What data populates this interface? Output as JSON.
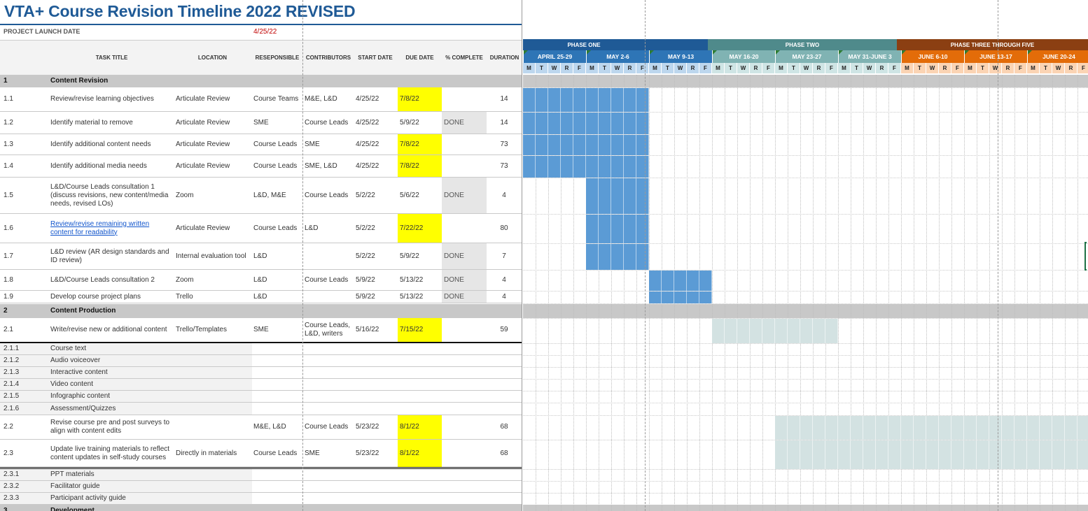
{
  "sheet": {
    "title": "VTA+ Course Revision Timeline 2022 REVISED",
    "launch_label": "PROJECT LAUNCH DATE",
    "launch_date": "4/25/22"
  },
  "columns": {
    "task": "TASK TITLE",
    "location": "LOCATION",
    "responsible": "RESEPONSIBLE",
    "contributors": "CONTRIBUTORS",
    "start": "START DATE",
    "due": "DUE DATE",
    "pct": "% COMPLETE",
    "duration": "DURATION"
  },
  "rows": [
    {
      "num": "1",
      "task": "Content Revision",
      "type": "section"
    },
    {
      "num": "1.1",
      "task": "Review/revise learning objectives",
      "loc": "Articulate Review",
      "resp": "Course Teams",
      "con": "M&E, L&D",
      "start": "4/25/22",
      "due": "7/8/22",
      "due_hl": true,
      "pct": "",
      "dur": "14"
    },
    {
      "num": "1.2",
      "task": "Identify material to remove",
      "loc": "Articulate Review",
      "resp": "SME",
      "con": "Course Leads",
      "start": "4/25/22",
      "due": "5/9/22",
      "pct": "DONE",
      "dur": "14"
    },
    {
      "num": "1.3",
      "task": "Identify additional content needs",
      "loc": "Articulate Review",
      "resp": "Course Leads",
      "con": "SME",
      "start": "4/25/22",
      "due": "7/8/22",
      "due_hl": true,
      "pct": "",
      "dur": "73"
    },
    {
      "num": "1.4",
      "task": "Identify additional media needs",
      "loc": "Articulate Review",
      "resp": "Course Leads",
      "con": "SME, L&D",
      "start": "4/25/22",
      "due": "7/8/22",
      "due_hl": true,
      "pct": "",
      "dur": "73"
    },
    {
      "num": "1.5",
      "task": "L&D/Course Leads consultation 1 (discuss revisions, new content/media needs, revised LOs)",
      "loc": "Zoom",
      "resp": "L&D, M&E",
      "con": "Course Leads",
      "start": "5/2/22",
      "due": "5/6/22",
      "pct": "DONE",
      "dur": "4"
    },
    {
      "num": "1.6",
      "task": "Review/revise remaining written content for readability",
      "link": true,
      "loc": "Articulate Review",
      "resp": "Course Leads",
      "con": "L&D",
      "start": "5/2/22",
      "due": "7/22/22",
      "due_hl": true,
      "pct": "",
      "dur": "80"
    },
    {
      "num": "1.7",
      "task": "L&D review (AR design standards and ID review)",
      "loc": "Internal evaluation tool",
      "resp": "L&D",
      "con": "",
      "start": "5/2/22",
      "due": "5/9/22",
      "pct": "DONE",
      "dur": "7"
    },
    {
      "num": "1.8",
      "task": "L&D/Course Leads consultation 2",
      "loc": "Zoom",
      "resp": "L&D",
      "con": "Course Leads",
      "start": "5/9/22",
      "due": "5/13/22",
      "pct": "DONE",
      "dur": "4"
    },
    {
      "num": "1.9",
      "task": "Develop course project plans",
      "loc": "Trello",
      "resp": "L&D",
      "con": "",
      "start": "5/9/22",
      "due": "5/13/22",
      "pct": "DONE",
      "dur": "4"
    },
    {
      "num": "2",
      "task": "Content Production",
      "type": "section"
    },
    {
      "num": "2.1",
      "task": "Write/revise new or additional content",
      "loc": "Trello/Templates",
      "resp": "SME",
      "con": "Course Leads, L&D, writers",
      "start": "5/16/22",
      "due": "7/15/22",
      "due_hl": true,
      "pct": "",
      "dur": "59"
    },
    {
      "num": "2.1.1",
      "task": "Course text",
      "type": "sub"
    },
    {
      "num": "2.1.2",
      "task": "Audio voiceover",
      "type": "sub"
    },
    {
      "num": "2.1.3",
      "task": "Interactive content",
      "type": "sub"
    },
    {
      "num": "2.1.4",
      "task": "Video content",
      "type": "sub"
    },
    {
      "num": "2.1.5",
      "task": "Infographic content",
      "type": "sub"
    },
    {
      "num": "2.1.6",
      "task": "Assessment/Quizzes",
      "type": "sub"
    },
    {
      "num": "2.2",
      "task": "Revise course pre and post surveys to align with content edits",
      "loc": "",
      "resp": "M&E, L&D",
      "con": "Course Leads",
      "start": "5/23/22",
      "due": "8/1/22",
      "due_hl": true,
      "pct": "",
      "dur": "68"
    },
    {
      "num": "2.3",
      "task": "Update live training materials to reflect content updates in self-study courses",
      "loc": "Directly in materials",
      "resp": "Course Leads",
      "con": "SME",
      "start": "5/23/22",
      "due": "8/1/22",
      "due_hl": true,
      "pct": "",
      "dur": "68"
    },
    {
      "num": "2.3.1",
      "task": "PPT materials",
      "type": "sub"
    },
    {
      "num": "2.3.2",
      "task": "Facilitator guide",
      "type": "sub"
    },
    {
      "num": "2.3.3",
      "task": "Participant activity guide",
      "type": "sub"
    },
    {
      "num": "3",
      "task": "Development",
      "type": "section"
    }
  ],
  "gantt": {
    "phases": [
      {
        "label": "PHASE ONE",
        "color": "#1f5a96"
      },
      {
        "label": "",
        "color": "#1f5a96"
      },
      {
        "label": "PHASE TWO",
        "color": "#4f8a8b"
      },
      {
        "label": "PHASE THREE THROUGH FIVE",
        "color": "#8b3f12"
      }
    ],
    "weeks": [
      {
        "label": "APRIL 25-29",
        "color": "#2e75b6",
        "day_bg": "#bdd7ee"
      },
      {
        "label": "MAY 2-6",
        "color": "#2e75b6",
        "day_bg": "#bdd7ee"
      },
      {
        "label": "MAY 9-13",
        "color": "#2e75b6",
        "day_bg": "#bdd7ee"
      },
      {
        "label": "MAY 16-20",
        "color": "#80b3b3",
        "day_bg": "#cfe5e5"
      },
      {
        "label": "MAY 23-27",
        "color": "#80b3b3",
        "day_bg": "#cfe5e5"
      },
      {
        "label": "MAY 31-JUNE 3",
        "color": "#80b3b3",
        "day_bg": "#cfe5e5"
      },
      {
        "label": "JUNE 6-10",
        "color": "#e36c09",
        "day_bg": "#fbd4b4"
      },
      {
        "label": "JUNE 13-17",
        "color": "#e36c09",
        "day_bg": "#fbd4b4"
      },
      {
        "label": "JUNE 20-24",
        "color": "#e36c09",
        "day_bg": "#fbd4b4"
      }
    ],
    "day_letters": [
      "M",
      "T",
      "W",
      "R",
      "F"
    ],
    "bar_colors": {
      "phase_one": "#5b9bd5",
      "phase_two": "#d3e2e2"
    }
  }
}
